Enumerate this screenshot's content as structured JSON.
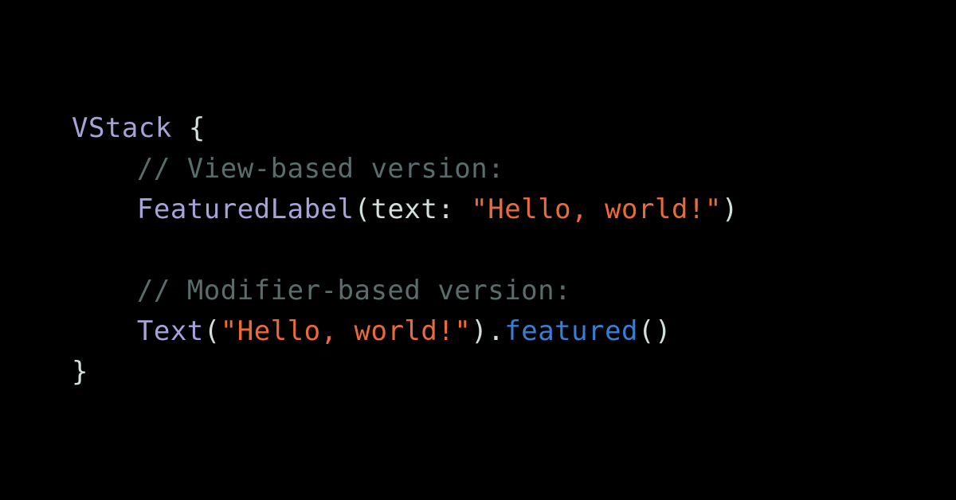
{
  "code": {
    "line1": {
      "vstack": "VStack",
      "space": " ",
      "brace_open": "{"
    },
    "line2": {
      "comment": "// View-based version:"
    },
    "line3": {
      "type": "FeaturedLabel",
      "paren_open": "(",
      "label": "text:",
      "space": " ",
      "string": "\"Hello, world!\"",
      "paren_close": ")"
    },
    "line4": {
      "blank": ""
    },
    "line5": {
      "comment": "// Modifier-based version:"
    },
    "line6": {
      "type": "Text",
      "paren_open": "(",
      "string": "\"Hello, world!\"",
      "paren_close_dot": ").",
      "method": "featured",
      "parens": "()"
    },
    "line7": {
      "brace_close": "}"
    }
  }
}
